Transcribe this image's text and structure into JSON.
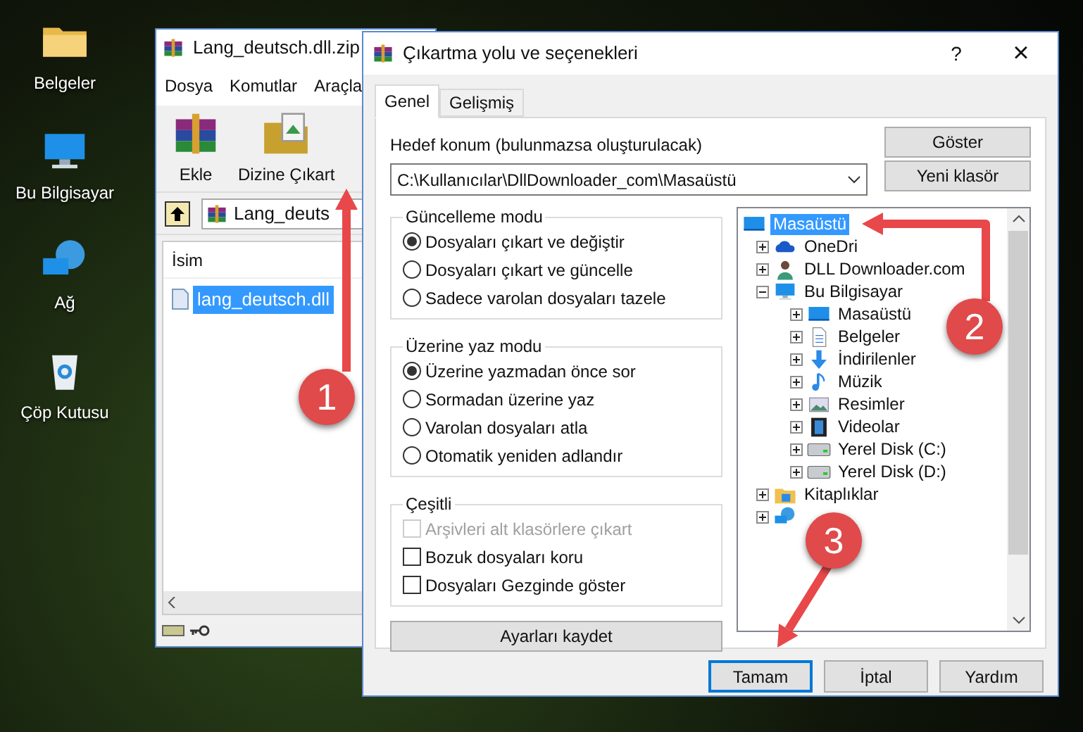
{
  "desktop": {
    "icons": [
      {
        "kind": "folder",
        "label": "Belgeler"
      },
      {
        "kind": "computer",
        "label": "Bu Bilgisayar"
      },
      {
        "kind": "network",
        "label": "Ağ"
      },
      {
        "kind": "bin",
        "label": "Çöp Kutusu"
      }
    ]
  },
  "archive_window": {
    "title": "Lang_deutsch.dll.zip",
    "menu": [
      "Dosya",
      "Komutlar",
      "Araçla"
    ],
    "toolbar": [
      {
        "kind": "add",
        "label": "Ekle"
      },
      {
        "kind": "extract",
        "label": "Dizine Çıkart"
      }
    ],
    "address": "Lang_deuts",
    "column": "İsim",
    "files": [
      {
        "name": "lang_deutsch.dll",
        "selected": true
      }
    ]
  },
  "dialog": {
    "title": "Çıkartma yolu ve seçenekleri",
    "help": "?",
    "close": "×",
    "tabs": [
      {
        "label": "Genel",
        "selected": true
      },
      {
        "label": "Gelişmiş",
        "selected": false
      }
    ],
    "destination_label": "Hedef konum (bulunmazsa oluşturulacak)",
    "destination": "C:\\Kullanıcılar\\DllDownloader_com\\Masaüstü",
    "side_buttons": [
      "Göster",
      "Yeni klasör"
    ],
    "groups": [
      {
        "title": "Güncelleme modu",
        "kind": "radio",
        "options": [
          {
            "label": "Dosyaları çıkart ve değiştir",
            "selected": true
          },
          {
            "label": "Dosyaları çıkart ve güncelle",
            "selected": false
          },
          {
            "label": "Sadece varolan dosyaları tazele",
            "selected": false
          }
        ]
      },
      {
        "title": "Üzerine yaz modu",
        "kind": "radio",
        "options": [
          {
            "label": "Üzerine yazmadan önce sor",
            "selected": true
          },
          {
            "label": "Sormadan üzerine yaz",
            "selected": false
          },
          {
            "label": "Varolan dosyaları atla",
            "selected": false
          },
          {
            "label": "Otomatik yeniden adlandır",
            "selected": false
          }
        ]
      },
      {
        "title": "Çeşitli",
        "kind": "checkbox",
        "options": [
          {
            "label": "Arşivleri alt klasörlere çıkart",
            "checked": false,
            "disabled": true
          },
          {
            "label": "Bozuk dosyaları koru",
            "checked": false,
            "disabled": false
          },
          {
            "label": "Dosyaları Gezginde göster",
            "checked": false,
            "disabled": false
          }
        ]
      }
    ],
    "save_button": "Ayarları kaydet",
    "tree": [
      {
        "kind": "desktop",
        "label": "Masaüstü",
        "selected": true,
        "children": [
          {
            "kind": "cloud",
            "label": "OneDri",
            "selected": false,
            "expanded": false
          },
          {
            "kind": "user",
            "label": "DLL Downloader.com",
            "selected": false,
            "expanded": false
          },
          {
            "kind": "computer",
            "label": "Bu Bilgisayar",
            "selected": false,
            "expanded": true,
            "children": [
              {
                "kind": "desktop",
                "label": "Masaüstü",
                "selected": false,
                "expanded": false
              },
              {
                "kind": "document",
                "label": "Belgeler",
                "selected": false,
                "expanded": false
              },
              {
                "kind": "download",
                "label": "İndirilenler",
                "selected": false,
                "expanded": false
              },
              {
                "kind": "music",
                "label": "Müzik",
                "selected": false,
                "expanded": false
              },
              {
                "kind": "pictures",
                "label": "Resimler",
                "selected": false,
                "expanded": false
              },
              {
                "kind": "video",
                "label": "Videolar",
                "selected": false,
                "expanded": false
              },
              {
                "kind": "drive",
                "label": "Yerel Disk (C:)",
                "selected": false,
                "expanded": false
              },
              {
                "kind": "drive",
                "label": "Yerel Disk (D:)",
                "selected": false,
                "expanded": false
              }
            ]
          },
          {
            "kind": "libraries",
            "label": "Kitaplıklar",
            "selected": false,
            "expanded": false
          },
          {
            "kind": "network",
            "expanded": false
          }
        ]
      }
    ],
    "buttons": [
      {
        "label": "Tamam",
        "selected": true
      },
      {
        "label": "İptal",
        "selected": false
      },
      {
        "label": "Yardım",
        "selected": false
      }
    ]
  },
  "callouts": [
    "1",
    "2",
    "3"
  ]
}
